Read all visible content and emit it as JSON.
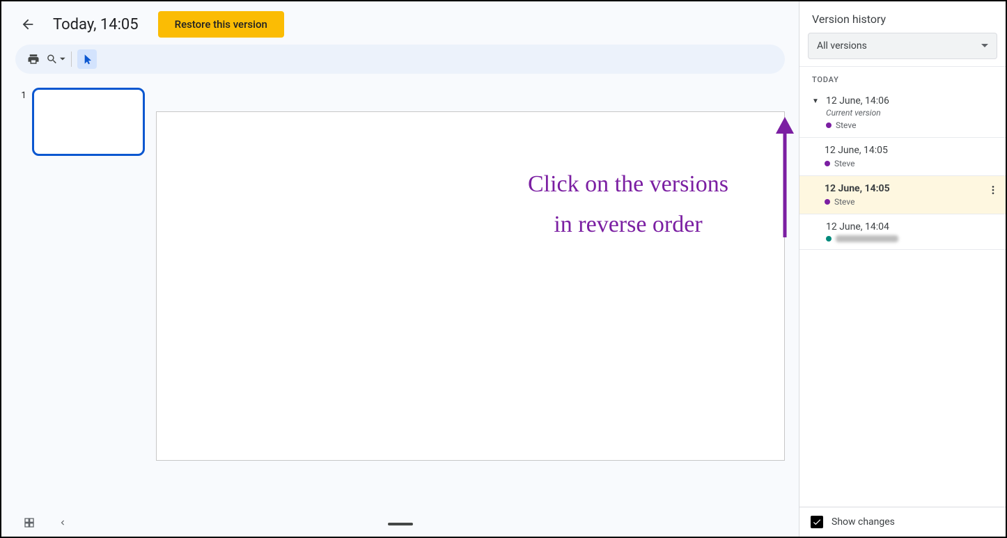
{
  "header": {
    "title": "Today, 14:05",
    "restore_label": "Restore this version"
  },
  "filmstrip": {
    "slide_number": "1"
  },
  "sidebar": {
    "title": "Version history",
    "dropdown_label": "All versions",
    "group_label": "TODAY",
    "versions": [
      {
        "time": "12 June, 14:06",
        "subtitle": "Current version",
        "editor": "Steve",
        "dot": "purple",
        "caret": true,
        "selected": false
      },
      {
        "time": "12 June, 14:05",
        "subtitle": "",
        "editor": "Steve",
        "dot": "purple",
        "caret": false,
        "selected": false
      },
      {
        "time": "12 June, 14:05",
        "subtitle": "",
        "editor": "Steve",
        "dot": "purple",
        "caret": false,
        "selected": true
      },
      {
        "time": "12 June, 14:04",
        "subtitle": "",
        "editor": "",
        "dot": "teal",
        "caret": false,
        "selected": false,
        "blurred": true
      }
    ],
    "show_changes_label": "Show changes"
  },
  "annotation": {
    "line1": "Click on the versions",
    "line2": "in reverse order"
  }
}
